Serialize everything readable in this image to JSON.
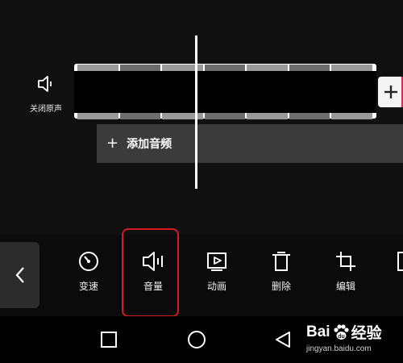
{
  "timeline": {
    "mute_label": "关闭原声",
    "add_audio_label": "添加音频",
    "add_audio_icon": "plus-icon",
    "add_clip_icon": "plus-icon"
  },
  "toolbar": {
    "tools": [
      {
        "label": "变速",
        "icon": "speed-icon"
      },
      {
        "label": "音量",
        "icon": "volume-icon",
        "highlighted": true
      },
      {
        "label": "动画",
        "icon": "animation-icon"
      },
      {
        "label": "删除",
        "icon": "delete-icon"
      },
      {
        "label": "编辑",
        "icon": "crop-icon"
      }
    ],
    "highlight_color": "#d41a22"
  },
  "navbar": {
    "icons": [
      "recent-apps-icon",
      "home-icon",
      "back-icon"
    ]
  },
  "watermark": {
    "brand_left": "Bai",
    "brand_right": "经验",
    "url": "jingyan.baidu.com"
  }
}
